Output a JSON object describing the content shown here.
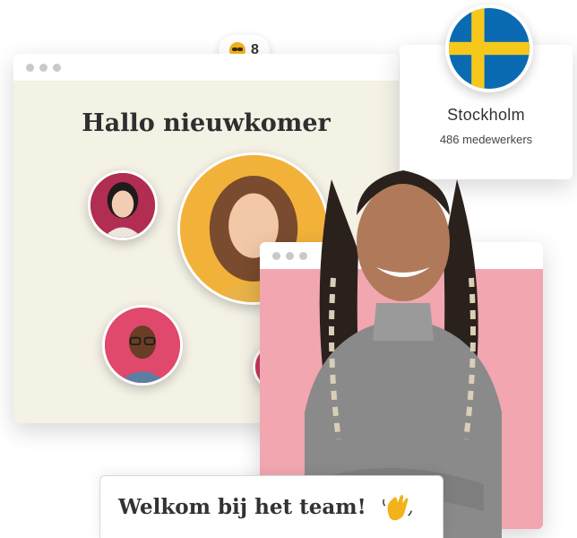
{
  "badge": {
    "icon": "nerd-face-emoji-icon",
    "count": "8"
  },
  "main_window": {
    "title": "Hallo nieuwkomer"
  },
  "avatars": [
    {
      "name": "avatar-woman-asian",
      "bg": "#b22d52"
    },
    {
      "name": "avatar-woman-curly",
      "bg": "#f2b23a"
    },
    {
      "name": "avatar-man-glasses",
      "bg": "#e0486c"
    }
  ],
  "location_card": {
    "flag": "sweden-flag-icon",
    "city": "Stockholm",
    "employees": "486 medewerkers"
  },
  "welcome": {
    "text": "Welkom bij het team!",
    "icon": "waving-hand-icon"
  },
  "colors": {
    "beige": "#f4f1e5",
    "pink": "#f1a6b0",
    "flag_blue": "#0a6bb3",
    "flag_yellow": "#f7c81c"
  }
}
